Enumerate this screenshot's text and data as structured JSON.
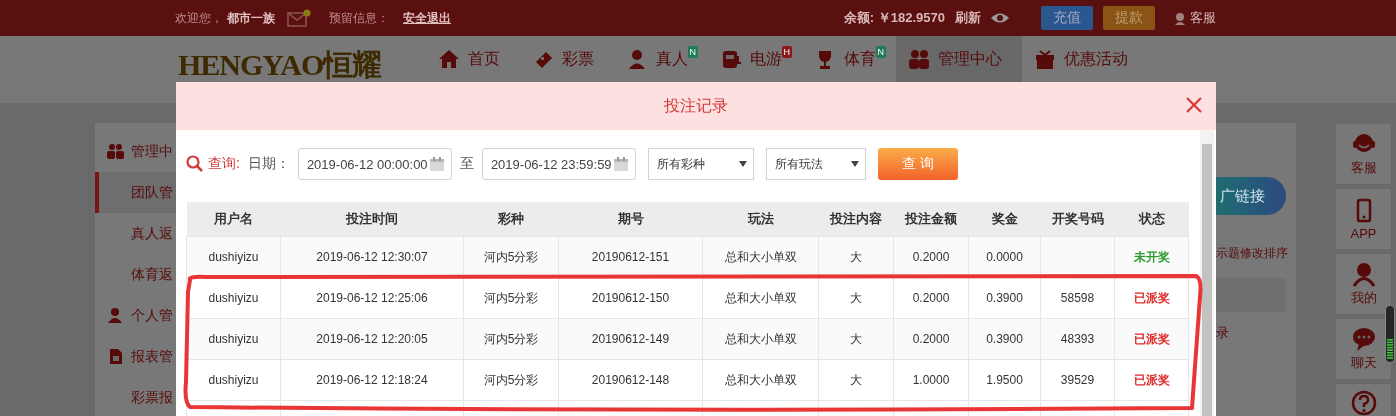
{
  "top_bar": {
    "welcome": "欢迎您，",
    "username": "都市一族",
    "notice_label": "预留信息：",
    "logout": "安全退出",
    "balance": "余额: ￥182.9570",
    "refresh": "刷新",
    "deposit": "充值",
    "withdraw": "提款",
    "service": "客服"
  },
  "nav": {
    "logo": "HENGYAO恒耀",
    "items": [
      {
        "label": "首页",
        "selected": false
      },
      {
        "label": "彩票",
        "selected": false
      },
      {
        "label": "真人",
        "badge": "N",
        "selected": false
      },
      {
        "label": "电游",
        "badge": "H",
        "selected": false
      },
      {
        "label": "体育",
        "badge": "N",
        "selected": false
      },
      {
        "label": "管理中心",
        "selected": true
      },
      {
        "label": "优惠活动",
        "selected": false
      }
    ]
  },
  "sidebar": {
    "items": [
      {
        "label": "管理中",
        "kind": "header",
        "selected": false
      },
      {
        "label": "团队管",
        "kind": "item",
        "selected": true
      },
      {
        "label": "真人返",
        "kind": "item",
        "selected": false
      },
      {
        "label": "体育返",
        "kind": "item",
        "selected": false
      },
      {
        "label": "个人管",
        "kind": "header",
        "selected": false
      },
      {
        "label": "报表管",
        "kind": "header",
        "selected": false
      },
      {
        "label": "彩票报",
        "kind": "item",
        "selected": false
      }
    ]
  },
  "content": {
    "link_button": "广链接",
    "hint": "示题修改排序",
    "row_text": "录"
  },
  "float_bar": {
    "items": [
      {
        "label": "客服"
      },
      {
        "label": "APP"
      },
      {
        "label": "我的"
      },
      {
        "label": "聊天"
      },
      {
        "kind": "help"
      }
    ]
  },
  "dialog": {
    "title": "投注记录",
    "query": {
      "label": "查询:",
      "date_label": "日期：",
      "start": "2019-06-12 00:00:00",
      "to": "至",
      "end": "2019-06-12 23:59:59",
      "lottery": "所有彩种",
      "play": "所有玩法",
      "button": "查 询"
    },
    "table": {
      "columns": [
        "用户名",
        "投注时间",
        "彩种",
        "期号",
        "玩法",
        "投注内容",
        "投注金额",
        "奖金",
        "开奖号码",
        "状态"
      ],
      "rows": [
        {
          "user": "dushiyizu",
          "time": "2019-06-12 12:30:07",
          "lottery": "河内5分彩",
          "period": "20190612-151",
          "play": "总和大小单双",
          "content": "大",
          "amount": "0.2000",
          "prize": "0.0000",
          "status": {
            "label": "未开奖",
            "color": "#2e9a2e"
          }
        },
        {
          "user": "dushiyizu",
          "time": "2019-06-12 12:25:06",
          "lottery": "河内5分彩",
          "period": "20190612-150",
          "play": "总和大小单双",
          "content": "大",
          "amount": "0.2000",
          "prize": "0.3900",
          "numbers": "58598",
          "status": {
            "label": "已派奖",
            "color": "#e02a2a"
          }
        },
        {
          "user": "dushiyizu",
          "time": "2019-06-12 12:20:05",
          "lottery": "河内5分彩",
          "period": "20190612-149",
          "play": "总和大小单双",
          "content": "大",
          "amount": "0.2000",
          "prize": "0.3900",
          "numbers": "48393",
          "status": {
            "label": "已派奖",
            "color": "#e02a2a"
          }
        },
        {
          "user": "dushiyizu",
          "time": "2019-06-12 12:18:24",
          "lottery": "河内5分彩",
          "period": "20190612-148",
          "play": "总和大小单双",
          "content": "大",
          "amount": "1.0000",
          "prize": "1.9500",
          "numbers": "39529",
          "status": {
            "label": "已派奖",
            "color": "#e02a2a"
          }
        }
      ]
    }
  }
}
